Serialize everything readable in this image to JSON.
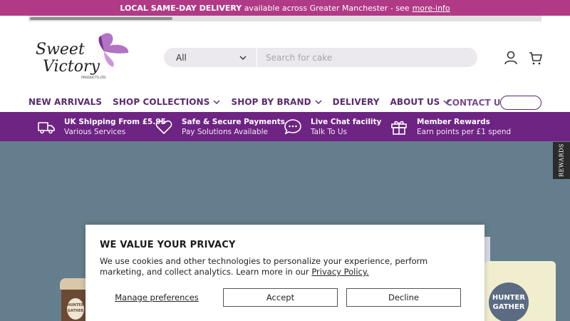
{
  "announcement": {
    "bold": "LOCAL SAME-DAY DELIVERY",
    "text": "available across Greater Manchester - see",
    "link": "more-info"
  },
  "header": {
    "logo": {
      "line1": "Sweet",
      "line2": "Victory",
      "line3": "PRODUCTS LTD"
    },
    "search": {
      "category": "All",
      "placeholder": "Search for cake"
    },
    "icons": [
      "account-icon",
      "cart-icon"
    ]
  },
  "nav": {
    "items": [
      {
        "label": "NEW ARRIVALS",
        "dropdown": false
      },
      {
        "label": "SHOP COLLECTIONS",
        "dropdown": true
      },
      {
        "label": "SHOP BY BRAND",
        "dropdown": true
      },
      {
        "label": "DELIVERY",
        "dropdown": false
      },
      {
        "label": "ABOUT US",
        "dropdown": true
      }
    ],
    "contact": "CONTACT US"
  },
  "features": [
    {
      "icon": "truck-icon",
      "title": "UK Shipping From £5.95",
      "subtitle": "Various Services"
    },
    {
      "icon": "heart-icon",
      "title": "Safe & Secure Payments",
      "subtitle": "Pay Solutions Available"
    },
    {
      "icon": "chat-icon",
      "title": "Live Chat facility",
      "subtitle": "Talk To Us"
    },
    {
      "icon": "gift-icon",
      "title": "Member Rewards",
      "subtitle": "Earn points per £1 spend"
    }
  ],
  "hero": {
    "product_label": "HUNTER GATHER",
    "jar_label": "HUNTER GATHER"
  },
  "rewards_tab": "REWARDS",
  "cookie": {
    "title": "WE VALUE YOUR PRIVACY",
    "text": "We use cookies and other technologies to personalize your experience, perform marketing, and collect analytics. Learn more in our",
    "link": "Privacy Policy.",
    "manage": "Manage preferences",
    "accept": "Accept",
    "decline": "Decline"
  },
  "colors": {
    "announcement_bg": "#b03a86",
    "features_bg": "#6e2483",
    "nav_text": "#5a2a6e",
    "hero_bg": "#657e8d"
  }
}
